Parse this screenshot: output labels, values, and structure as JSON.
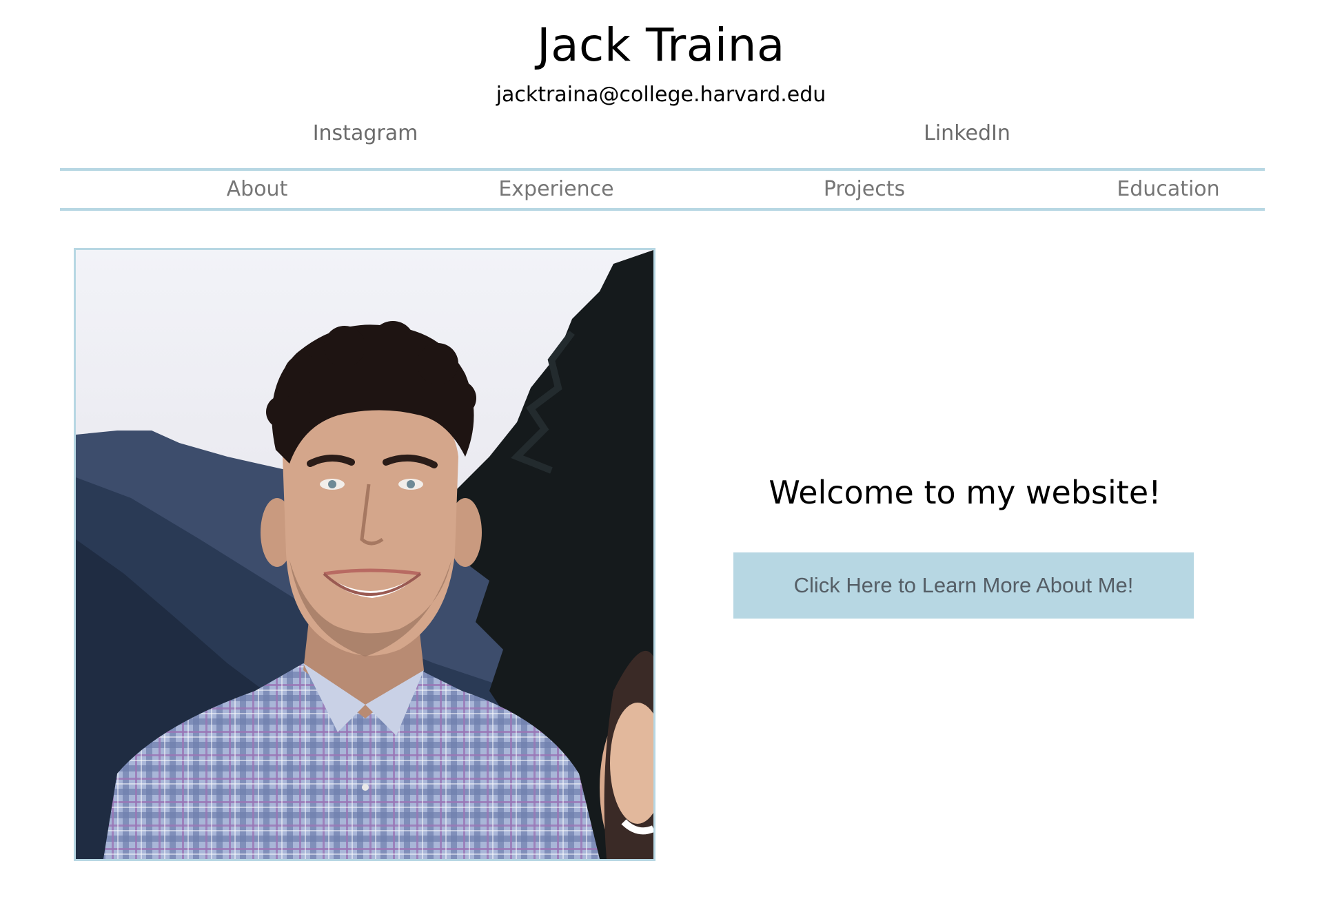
{
  "header": {
    "name": "Jack Traina",
    "email": "jacktraina@college.harvard.edu",
    "social": [
      {
        "label": "Instagram"
      },
      {
        "label": "LinkedIn"
      }
    ]
  },
  "nav": {
    "items": [
      {
        "label": "About"
      },
      {
        "label": "Experience"
      },
      {
        "label": "Projects"
      },
      {
        "label": "Education"
      }
    ]
  },
  "hero": {
    "welcome": "Welcome to my website!",
    "cta_label": "Click Here to Learn More About Me!"
  },
  "colors": {
    "accent": "#b7d7e3",
    "nav_text": "#767676",
    "button_text": "#555e66"
  }
}
